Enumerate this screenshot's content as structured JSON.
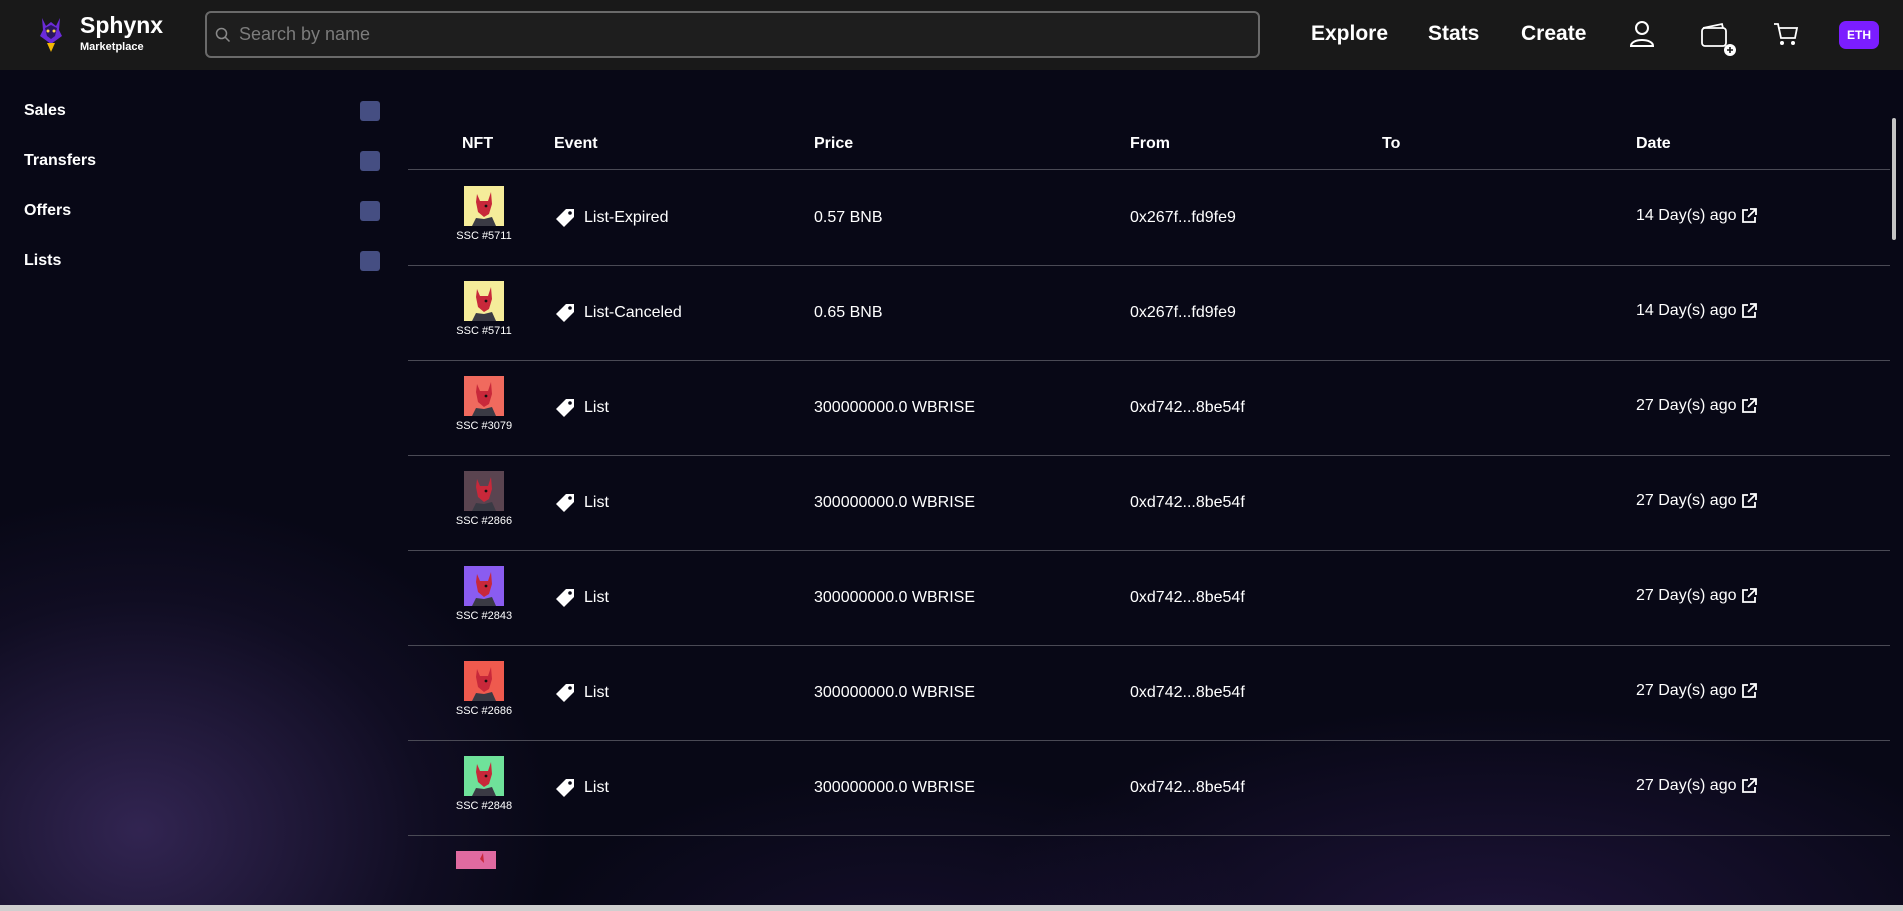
{
  "header": {
    "brand_name": "Sphynx",
    "brand_sub": "Marketplace",
    "search_placeholder": "Search by name",
    "nav": [
      "Explore",
      "Stats",
      "Create"
    ],
    "chain_badge": "ETH",
    "icons": [
      "user-icon",
      "wallet-icon",
      "cart-icon"
    ]
  },
  "sidebar": {
    "filters": [
      {
        "label": "Sales"
      },
      {
        "label": "Transfers"
      },
      {
        "label": "Offers"
      },
      {
        "label": "Lists"
      }
    ]
  },
  "table": {
    "columns": [
      "NFT",
      "Event",
      "Price",
      "From",
      "To",
      "Date"
    ],
    "rows": [
      {
        "nft": "SSC #5711",
        "thumb_bg": "#f5ec9a",
        "event": "List-Expired",
        "price": "0.57 BNB",
        "from": "0x267f...fd9fe9",
        "to": "",
        "date": "14 Day(s) ago"
      },
      {
        "nft": "SSC #5711",
        "thumb_bg": "#f5ec9a",
        "event": "List-Canceled",
        "price": "0.65 BNB",
        "from": "0x267f...fd9fe9",
        "to": "",
        "date": "14 Day(s) ago"
      },
      {
        "nft": "SSC #3079",
        "thumb_bg": "#f06a5e",
        "event": "List",
        "price": "300000000.0 WBRISE",
        "from": "0xd742...8be54f",
        "to": "",
        "date": "27 Day(s) ago"
      },
      {
        "nft": "SSC #2866",
        "thumb_bg": "#5a4450",
        "event": "List",
        "price": "300000000.0 WBRISE",
        "from": "0xd742...8be54f",
        "to": "",
        "date": "27 Day(s) ago"
      },
      {
        "nft": "SSC #2843",
        "thumb_bg": "#8a5cf0",
        "event": "List",
        "price": "300000000.0 WBRISE",
        "from": "0xd742...8be54f",
        "to": "",
        "date": "27 Day(s) ago"
      },
      {
        "nft": "SSC #2686",
        "thumb_bg": "#ef5a4e",
        "event": "List",
        "price": "300000000.0 WBRISE",
        "from": "0xd742...8be54f",
        "to": "",
        "date": "27 Day(s) ago"
      },
      {
        "nft": "SSC #2848",
        "thumb_bg": "#6fe29a",
        "event": "List",
        "price": "300000000.0 WBRISE",
        "from": "0xd742...8be54f",
        "to": "",
        "date": "27 Day(s) ago"
      }
    ],
    "partial_row_thumb_bg": "#e06aa0"
  },
  "colors": {
    "accent": "#7b1dff",
    "checkbox": "#454e82",
    "header_bg": "#191919"
  }
}
